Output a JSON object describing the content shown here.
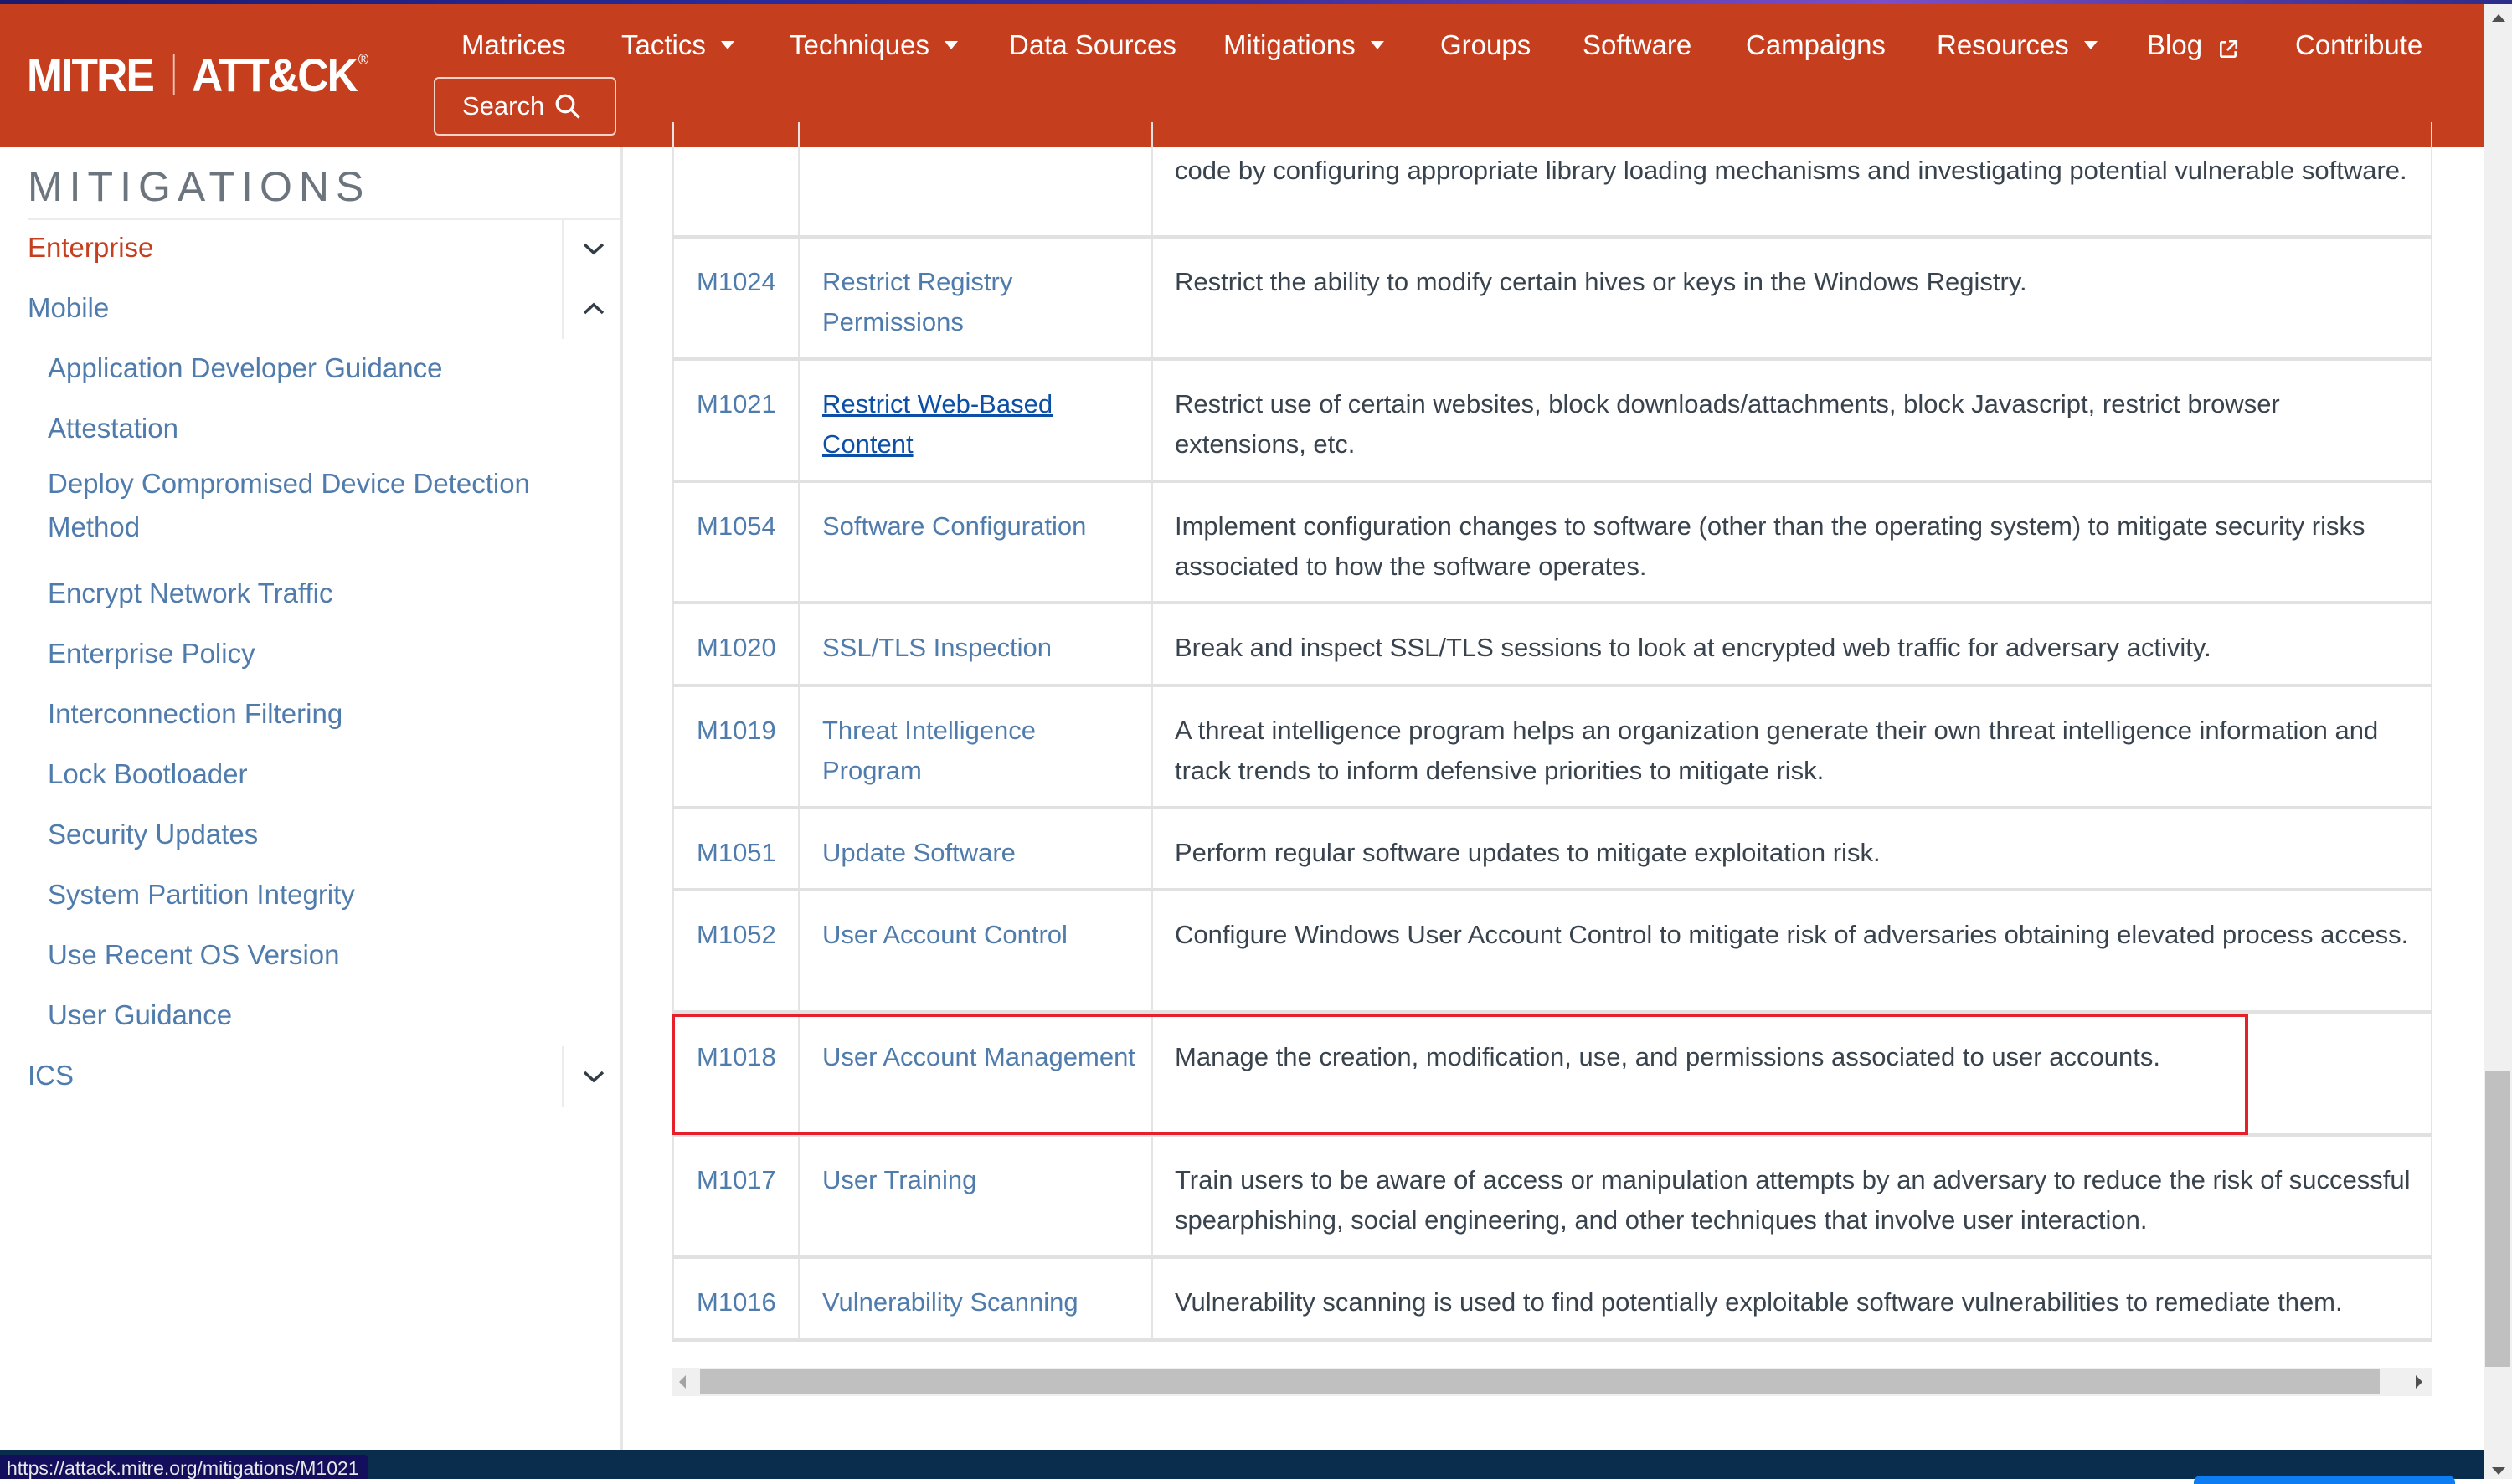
{
  "brand": {
    "left": "MITRE",
    "right": "ATT&CK",
    "registered": "®"
  },
  "nav": {
    "items": [
      {
        "label": "Matrices",
        "dropdown": false
      },
      {
        "label": "Tactics",
        "dropdown": true
      },
      {
        "label": "Techniques",
        "dropdown": true
      },
      {
        "label": "Data Sources",
        "dropdown": false
      },
      {
        "label": "Mitigations",
        "dropdown": true
      },
      {
        "label": "Groups",
        "dropdown": false
      },
      {
        "label": "Software",
        "dropdown": false
      },
      {
        "label": "Campaigns",
        "dropdown": false
      },
      {
        "label": "Resources",
        "dropdown": true
      },
      {
        "label": "Blog",
        "dropdown": false,
        "external": true
      },
      {
        "label": "Contribute",
        "dropdown": false
      }
    ],
    "search_label": "Search"
  },
  "sidebar": {
    "title": "MITIGATIONS",
    "sections": [
      {
        "label": "Enterprise",
        "state": "collapsed",
        "active": true
      },
      {
        "label": "Mobile",
        "state": "expanded",
        "active": false
      },
      {
        "label": "ICS",
        "state": "collapsed",
        "active": false
      }
    ],
    "mobile_items": [
      "Application Developer Guidance",
      "Attestation",
      "Deploy Compromised Device Detection Method",
      "Encrypt Network Traffic",
      "Enterprise Policy",
      "Interconnection Filtering",
      "Lock Bootloader",
      "Security Updates",
      "System Partition Integrity",
      "Use Recent OS Version",
      "User Guidance"
    ]
  },
  "table": {
    "partial_row": {
      "id": "",
      "name": "",
      "description": "code by configuring appropriate library loading mechanisms and investigating potential vulnerable software."
    },
    "rows": [
      {
        "id": "M1024",
        "name": "Restrict Registry Permissions",
        "description": "Restrict the ability to modify certain hives or keys in the Windows Registry."
      },
      {
        "id": "M1021",
        "name": "Restrict Web-Based Content",
        "description": "Restrict use of certain websites, block downloads/attachments, block Javascript, restrict browser extensions, etc.",
        "hovered": true
      },
      {
        "id": "M1054",
        "name": "Software Configuration",
        "description": "Implement configuration changes to software (other than the operating system) to mitigate security risks associated to how the software operates."
      },
      {
        "id": "M1020",
        "name": "SSL/TLS Inspection",
        "description": "Break and inspect SSL/TLS sessions to look at encrypted web traffic for adversary activity."
      },
      {
        "id": "M1019",
        "name": "Threat Intelligence Program",
        "description": "A threat intelligence program helps an organization generate their own threat intelligence information and track trends to inform defensive priorities to mitigate risk."
      },
      {
        "id": "M1051",
        "name": "Update Software",
        "description": "Perform regular software updates to mitigate exploitation risk."
      },
      {
        "id": "M1052",
        "name": "User Account Control",
        "description": "Configure Windows User Account Control to mitigate risk of adversaries obtaining elevated process access."
      },
      {
        "id": "M1018",
        "name": "User Account Management",
        "description": "Manage the creation, modification, use, and permissions associated to user accounts.",
        "highlighted": true
      },
      {
        "id": "M1017",
        "name": "User Training",
        "description": "Train users to be aware of access or manipulation attempts by an adversary to reduce the risk of successful spearphishing, social engineering, and other techniques that involve user interaction."
      },
      {
        "id": "M1016",
        "name": "Vulnerability Scanning",
        "description": "Vulnerability scanning is used to find potentially exploitable software vulnerabilities to remediate them."
      }
    ]
  },
  "status_bar": {
    "url": "https://attack.mitre.org/mitigations/M1021"
  },
  "colors": {
    "brand": "#c53f1f",
    "link": "#4f7cac",
    "link_hover": "#0b4fa6",
    "text": "#39434d",
    "highlight_box": "#e5202a"
  }
}
